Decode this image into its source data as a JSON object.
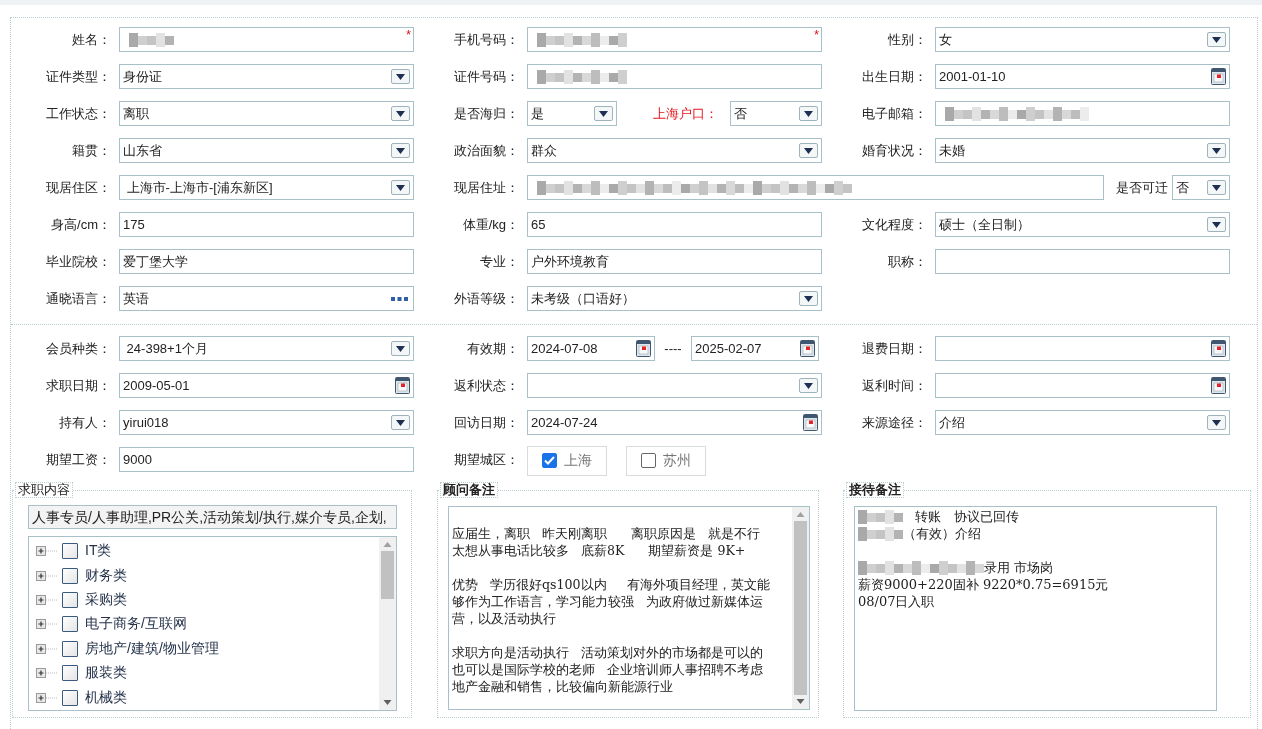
{
  "sections": [
    {
      "rows": [
        [
          {
            "label": "姓名：",
            "kind": "text",
            "redacted": true,
            "mark": "*"
          },
          {
            "label": "手机号码：",
            "kind": "text",
            "redacted": true,
            "mark": "*"
          },
          {
            "label": "性别：",
            "kind": "select",
            "value": "女"
          }
        ],
        [
          {
            "label": "证件类型：",
            "kind": "select",
            "value": "身份证"
          },
          {
            "label": "证件号码：",
            "kind": "text",
            "redacted": true
          },
          {
            "label": "出生日期：",
            "kind": "date",
            "value": "2001-01-10"
          }
        ],
        [
          {
            "label": "工作状态：",
            "kind": "select",
            "value": "离职"
          },
          {
            "label": "是否海归：",
            "kind": "select",
            "value": "是",
            "extra": {
              "label": "上海户口：",
              "kind": "select",
              "value": "否",
              "emphasized": true
            }
          },
          {
            "label": "电子邮箱：",
            "kind": "text",
            "redacted": true
          }
        ],
        [
          {
            "label": "籍贯：",
            "kind": "select",
            "value": "山东省"
          },
          {
            "label": "政治面貌：",
            "kind": "select",
            "value": "群众"
          },
          {
            "label": "婚育状况：",
            "kind": "select",
            "value": "未婚"
          }
        ],
        [
          {
            "label": "现居住区：",
            "kind": "select",
            "value": " 上海市-上海市-[浦东新区]"
          },
          {
            "label": "现居住址：",
            "kind": "text",
            "redacted": true,
            "wide": true,
            "extra": {
              "label": "是否可迁",
              "kind": "select",
              "value": "否",
              "emphasized": false
            }
          }
        ],
        [
          {
            "label": "身高/cm：",
            "kind": "text",
            "value": "175"
          },
          {
            "label": "体重/kg：",
            "kind": "text",
            "value": "65"
          },
          {
            "label": "文化程度：",
            "kind": "select",
            "value": "硕士（全日制）"
          }
        ],
        [
          {
            "label": "毕业院校：",
            "kind": "text",
            "value": "爱丁堡大学"
          },
          {
            "label": "专业：",
            "kind": "text",
            "value": "户外环境教育"
          },
          {
            "label": "职称：",
            "kind": "text"
          }
        ],
        [
          {
            "label": "通晓语言：",
            "kind": "lookup",
            "value": "英语"
          },
          {
            "label": "外语等级：",
            "kind": "select",
            "value": "未考级（口语好）"
          }
        ]
      ]
    },
    {
      "rows": [
        [
          {
            "label": "会员种类：",
            "kind": "select",
            "value": " 24-398+1个月"
          },
          {
            "label": "有效期：",
            "kind": "range",
            "from": "2024-07-08",
            "separator": "----",
            "to": "2025-02-07"
          },
          {
            "label": "退费日期：",
            "kind": "date"
          }
        ],
        [
          {
            "label": "求职日期：",
            "kind": "date",
            "value": "2009-05-01"
          },
          {
            "label": "返利状态：",
            "kind": "select"
          },
          {
            "label": "返利时间：",
            "kind": "date"
          }
        ],
        [
          {
            "label": "持有人：",
            "kind": "select",
            "value": "yirui018"
          },
          {
            "label": "回访日期：",
            "kind": "date",
            "value": "2024-07-24"
          },
          {
            "label": "来源途径：",
            "kind": "select",
            "value": "介绍"
          }
        ],
        [
          {
            "label": "期望工资：",
            "kind": "text",
            "value": "9000"
          },
          {
            "label": "期望城区：",
            "kind": "checks",
            "options": [
              {
                "label": "上海",
                "checked": true
              },
              {
                "label": "苏州",
                "checked": false
              }
            ]
          }
        ]
      ]
    }
  ],
  "panels": [
    {
      "kind": "tree",
      "legend": "求职内容",
      "summary": "人事专员/人事助理,PR公关,活动策划/执行,媒介专员,企划,",
      "items": [
        {
          "label": "IT类",
          "checked": false,
          "expanded": false
        },
        {
          "label": "财务类",
          "checked": false,
          "expanded": false
        },
        {
          "label": "采购类",
          "checked": false,
          "expanded": false
        },
        {
          "label": "电子商务/互联网",
          "checked": false,
          "expanded": false
        },
        {
          "label": "房地产/建筑/物业管理",
          "checked": false,
          "expanded": false
        },
        {
          "label": "服装类",
          "checked": false,
          "expanded": false
        },
        {
          "label": "机械类",
          "checked": false,
          "expanded": false
        }
      ]
    },
    {
      "kind": "notes",
      "legend": "顾问备注",
      "scrollable": true,
      "paragraphs": [
        [
          {
            "text": "应届生，离职   昨天刚离职      离职原因是   就是不行"
          },
          {
            "text": "太想从事电话比较多   底薪8K      期望薪资是 9K+"
          }
        ],
        [
          {
            "text": "优势   学历很好qs100以内     有海外项目经理，英文能"
          },
          {
            "text": "够作为工作语言，学习能力较强   为政府做过新媒体运"
          },
          {
            "text": "营，以及活动执行"
          }
        ],
        [
          {
            "text": "求职方向是活动执行   活动策划对外的市场都是可以的"
          },
          {
            "text": "也可以是国际学校的老师   企业培训师人事招聘不考虑"
          },
          {
            "text": "地产金融和销售，比较偏向新能源行业"
          }
        ]
      ]
    },
    {
      "kind": "notes",
      "legend": "接待备注",
      "paragraphs": [
        [
          {
            "text": "   转账   协议已回传",
            "redacted": true
          },
          {
            "text": "（有效）介绍",
            "redacted": true
          }
        ],
        [
          {
            "text": "录用 市场岗",
            "redacted": true
          },
          {
            "text": "薪资9000+220固补 9220*0.75=6915元"
          },
          {
            "text": "08/07日入职"
          }
        ]
      ]
    }
  ]
}
